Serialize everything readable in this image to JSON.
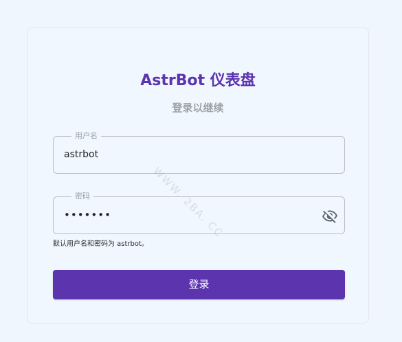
{
  "login": {
    "title": "AstrBot 仪表盘",
    "subtitle": "登录以继续",
    "username": {
      "label": "用户名",
      "value": "astrbot"
    },
    "password": {
      "label": "密码",
      "value": "•••••••",
      "toggle_icon": "eye-off-icon"
    },
    "hint": "默认用户名和密码为 astrbot。",
    "submit_label": "登录"
  },
  "watermark": "WWW. 2BA. CC",
  "colors": {
    "accent": "#5c35ae",
    "background": "#f0f6fd",
    "muted_text": "#9ca1a8"
  }
}
